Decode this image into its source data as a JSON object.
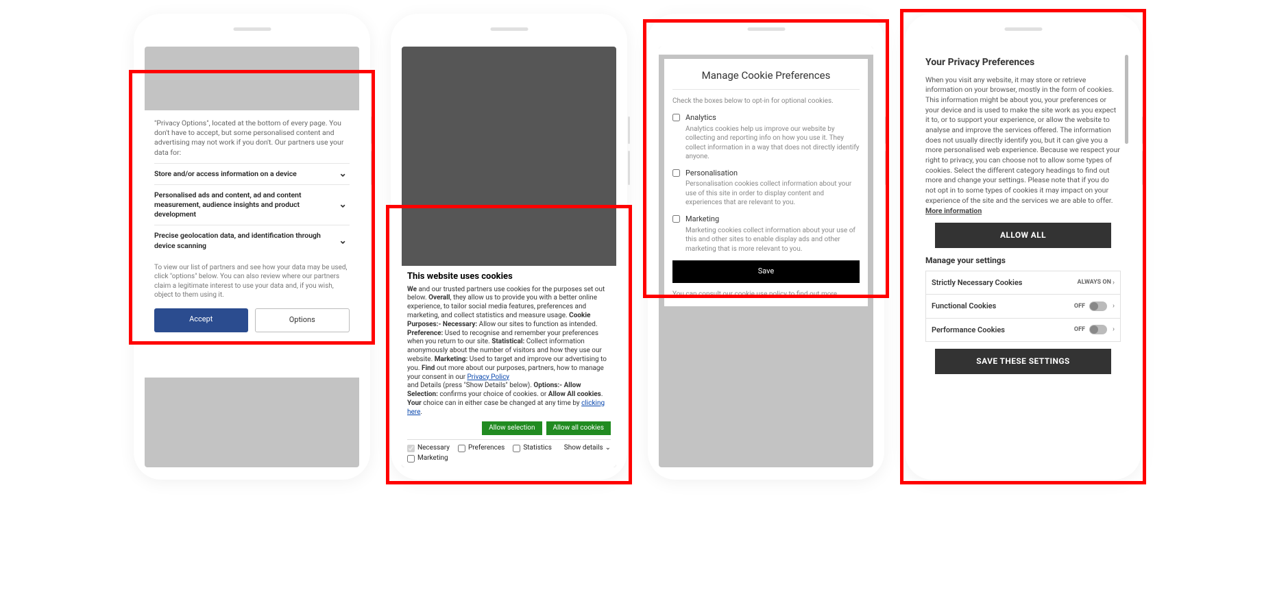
{
  "phone1": {
    "intro": "\"Privacy Options\", located at the bottom of every page. You don't have to accept, but some personalised content and advertising may not work if you don't. Our partners use your data for:",
    "rows": [
      "Store and/or access information on a device",
      "Personalised ads and content, ad and content measurement, audience insights and product development",
      "Precise geolocation data, and identification through device scanning"
    ],
    "note": "To view our list of partners and see how your data may be used, click \"options\" below. You can also review where our partners claim a legitimate interest to use your data and, if you wish, object to them using it.",
    "accept": "Accept",
    "options": "Options"
  },
  "phone2": {
    "title": "This website uses cookies",
    "bold": {
      "we": "We",
      "overall": "Overall",
      "purposes": "Cookie Purposes:- Necessary:",
      "preference": "Preference:",
      "statistical": "Statistical:",
      "marketing": "Marketing:",
      "find": "Find",
      "options": "Options:- Allow Selection:",
      "allowall": "Allow All cookies",
      "your": "Your"
    },
    "txt": {
      "p1": " and our trusted partners use cookies for the purposes set out below. ",
      "p2": ", they allow us to provide you with a better online experience, to tailor social media features, preferences and marketing, and collect statistics and measure usage. ",
      "p3": " Allow our sites to function as intended. ",
      "p4": " Used to recognise and remember your preferences when you return to our site. ",
      "p5": " Collect information anonymously about the number of visitors and how they use our website. ",
      "p6": " Used to target and improve our advertising to you. ",
      "p7": " out more about our purposes, partners, how to manage your consent in our ",
      "ppolicy": "Privacy Policy",
      "p8": " and Details (press \"Show Details\" below). ",
      "p9": " confirms your choice of cookies. or ",
      "p10": ". ",
      "p11": " choice can in either case be changed at any time by ",
      "clicking": "clicking here",
      "dot": "."
    },
    "allow_selection": "Allow selection",
    "allow_all": "Allow all cookies",
    "checks": {
      "necessary": "Necessary",
      "preferences": "Preferences",
      "statistics": "Statistics",
      "marketing": "Marketing"
    },
    "show_details": "Show details"
  },
  "phone3": {
    "title": "Manage Cookie Preferences",
    "intro": "Check the boxes below to opt-in for optional cookies.",
    "cats": [
      {
        "name": "Analytics",
        "desc": "Analytics cookies help us improve our website by collecting and reporting info on how you use it. They collect information in a way that does not directly identify anyone."
      },
      {
        "name": "Personalisation",
        "desc": "Personalisation cookies collect information about your use of this site in order to display content and experiences that are relevant to you."
      },
      {
        "name": "Marketing",
        "desc": "Marketing cookies collect information about your use of this and other sites to enable display ads and other marketing that is more relevant to you."
      }
    ],
    "save": "Save",
    "footer_pre": "You can consult our ",
    "footer_link": "cookie use policy",
    "footer_post": " to find out more."
  },
  "phone4": {
    "title": "Your Privacy Preferences",
    "body": "When you visit any website, it may store or retrieve information on your browser, mostly in the form of cookies. This information might be about you, your preferences or your device and is used to make the site work as you expect it to, or to support your experience, or allow the website to analyse and improve the services offered. The information does not usually directly identify you, but it can give you a more personalised web experience. Because we respect your right to privacy, you can choose not to allow some types of cookies. Select the different category headings to find out more and change your settings. Please note that if you do not opt in to some types of cookies it may impact on your experience of the site and the services we are able to offer.  ",
    "more_info": "More information",
    "allow_all": "ALLOW ALL",
    "manage": "Manage your settings",
    "rows": [
      {
        "name": "Strictly Necessary Cookies",
        "state": "ALWAYS ON",
        "toggle": false
      },
      {
        "name": "Functional Cookies",
        "state": "OFF",
        "toggle": true
      },
      {
        "name": "Performance Cookies",
        "state": "OFF",
        "toggle": true
      }
    ],
    "save": "SAVE THESE SETTINGS"
  }
}
